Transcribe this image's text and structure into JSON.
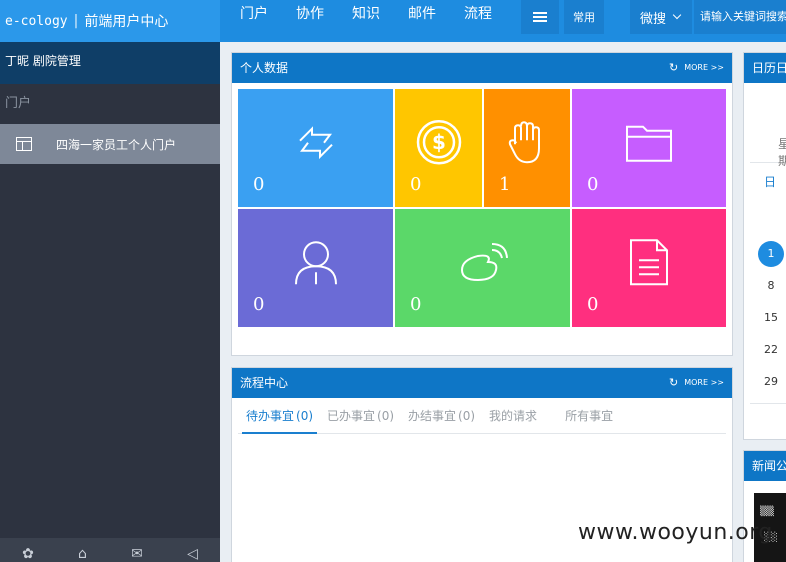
{
  "header": {
    "logo": "e-cology",
    "title": "前端用户中心",
    "nav": [
      "门户",
      "协作",
      "知识",
      "邮件",
      "流程"
    ],
    "common_label": "常用",
    "search_scope": "微搜",
    "search_placeholder": "请输入关键词搜索"
  },
  "sidebar": {
    "user": "丁昵 剧院管理",
    "section": "门户",
    "item": "四海一家员工个人门户"
  },
  "personal_panel": {
    "title": "个人数据",
    "more": "MORE >>",
    "tiles": [
      {
        "icon": "exchange-icon",
        "count": "0",
        "color": "#3aa0f2"
      },
      {
        "icon": "coin-icon",
        "count": "0",
        "color": "#ffc600"
      },
      {
        "icon": "hand-icon",
        "count": "1",
        "color": "#ff9000"
      },
      {
        "icon": "folder-icon",
        "count": "0",
        "color": "#c65dff"
      },
      {
        "icon": "user-icon",
        "count": "0",
        "color": "#6b6bd6"
      },
      {
        "icon": "weibo-icon",
        "count": "0",
        "color": "#5bd869"
      },
      {
        "icon": "document-icon",
        "count": "0",
        "color": "#ff2f7f"
      }
    ]
  },
  "workflow_panel": {
    "title": "流程中心",
    "more": "MORE >>",
    "tabs": [
      {
        "label": "待办事宜",
        "count": "(0)"
      },
      {
        "label": "已办事宜",
        "count": "(0)"
      },
      {
        "label": "办结事宜",
        "count": "(0)"
      },
      {
        "label": "我的请求",
        "count": ""
      },
      {
        "label": "所有事宜",
        "count": ""
      }
    ]
  },
  "calendar_panel": {
    "title": "日历日程",
    "week": "星期",
    "dow": "日",
    "today": "1",
    "days": [
      "8",
      "15",
      "22",
      "29"
    ]
  },
  "news_panel": {
    "title": "新闻公告"
  },
  "watermark": "www.wooyun.org"
}
